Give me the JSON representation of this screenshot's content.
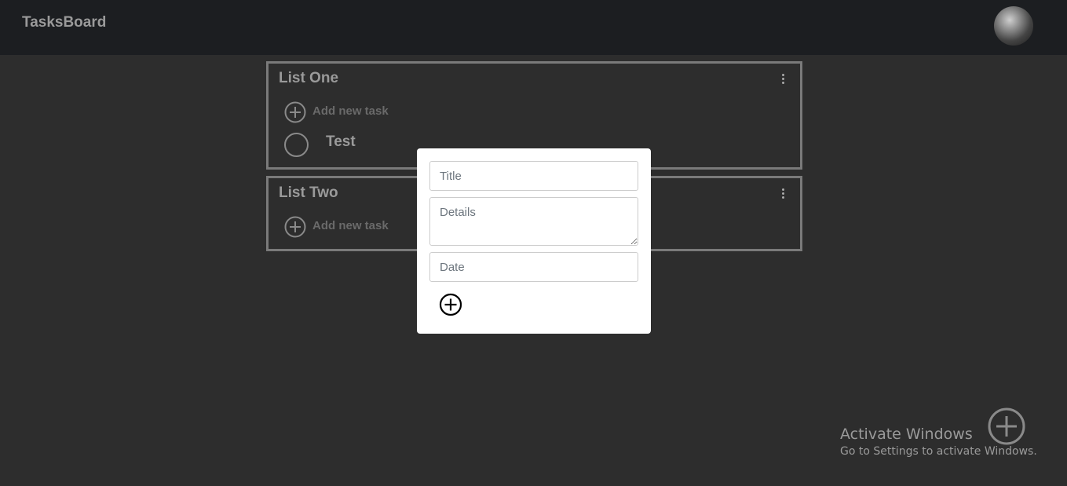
{
  "app": {
    "title": "TasksBoard"
  },
  "lists": [
    {
      "title": "List One",
      "add_label": "Add new task",
      "tasks": [
        {
          "title": "Test"
        }
      ]
    },
    {
      "title": "List Two",
      "add_label": "Add new task",
      "tasks": []
    }
  ],
  "new_task_form": {
    "title_placeholder": "Title",
    "details_placeholder": "Details",
    "date_placeholder": "Date"
  },
  "watermark": {
    "title": "Activate Windows",
    "subtitle": "Go to Settings to activate Windows."
  },
  "icons": {
    "avatar": "avatar",
    "list_menu": "kebab-menu-icon",
    "add": "plus-circle-icon",
    "task_toggle": "circle-icon"
  },
  "colors": {
    "background": "#2d2d2d",
    "topbar": "#1c1e21",
    "card_border": "#7a7a7a",
    "modal": "#ffffff"
  }
}
